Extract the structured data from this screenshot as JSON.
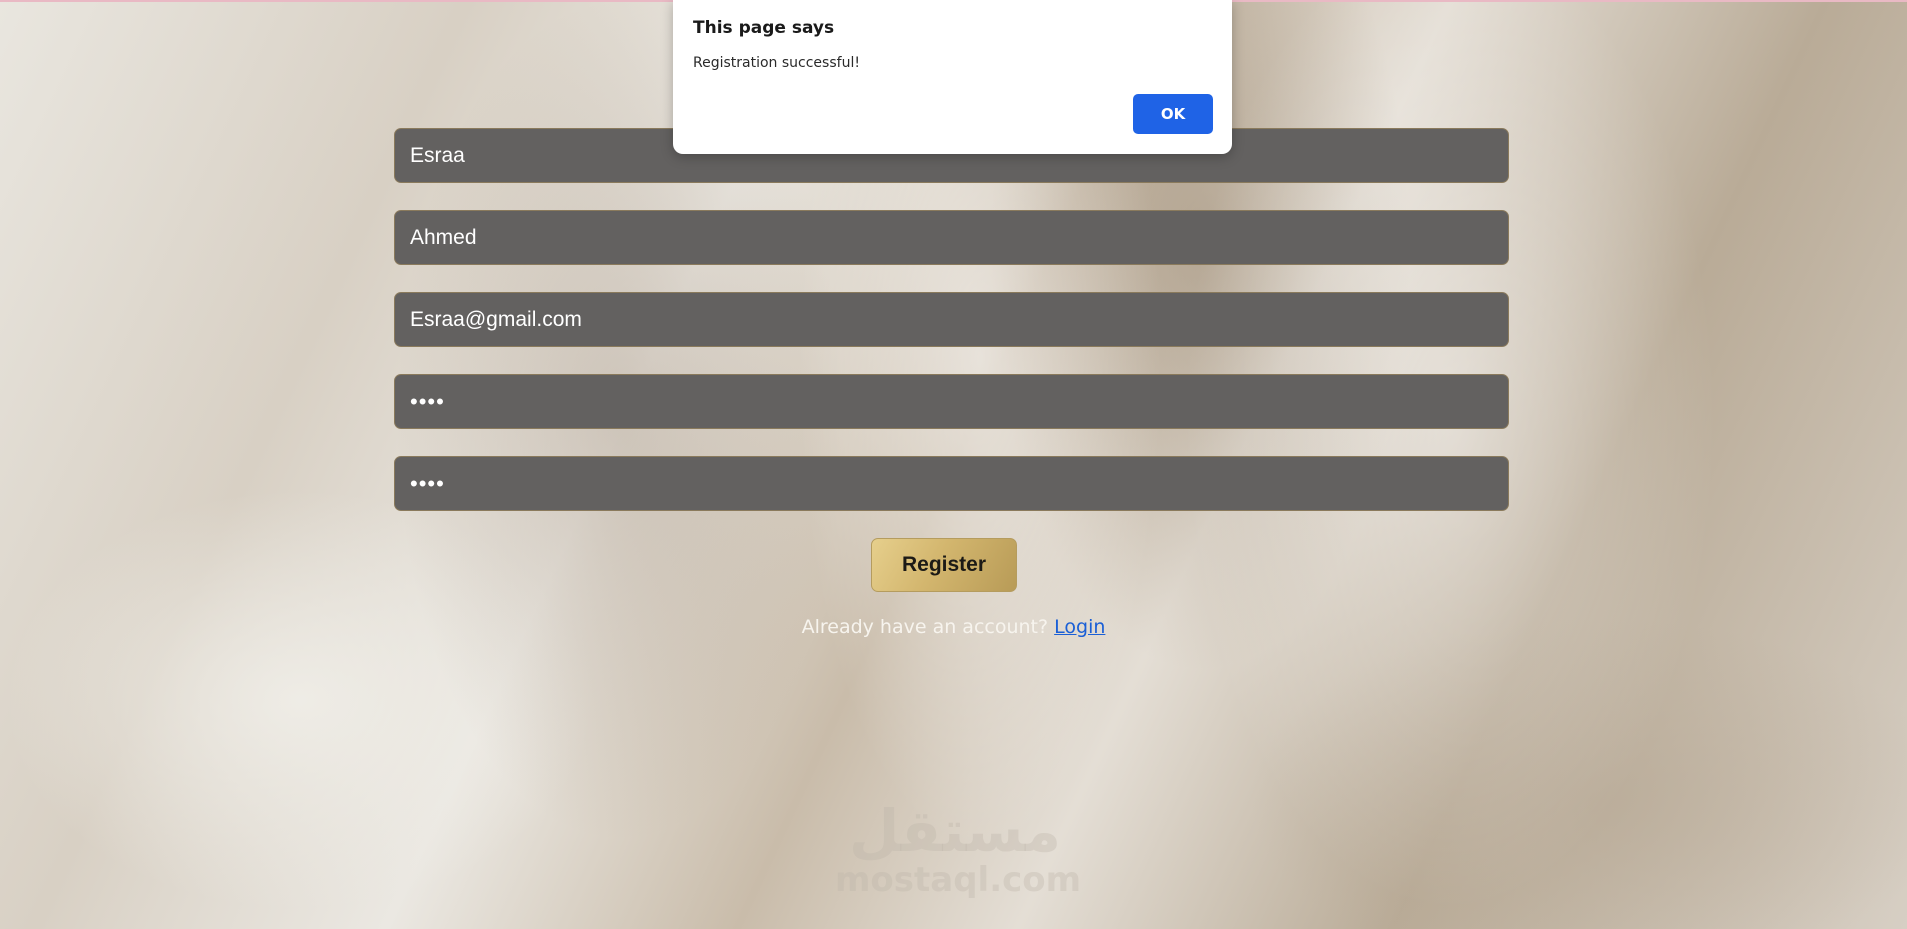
{
  "form": {
    "first_name_value": "Esraa",
    "last_name_value": "Ahmed",
    "email_value": "Esraa@gmail.com",
    "password_value": "••••",
    "confirm_password_value": "••••",
    "register_label": "Register",
    "login_prompt": "Already have an account?",
    "login_link": "Login"
  },
  "dialog": {
    "title": "This page says",
    "message": "Registration successful!",
    "ok_label": "OK"
  },
  "watermark": {
    "arabic": "مستقل",
    "latin": "mostaql.com"
  },
  "colors": {
    "field_bg": "#636160",
    "register_gradient_start": "#e6cf8c",
    "register_gradient_end": "#b89b57",
    "link": "#1a5fd6",
    "ok_button": "#1f63e6",
    "top_accent": "#e9b9c4"
  }
}
